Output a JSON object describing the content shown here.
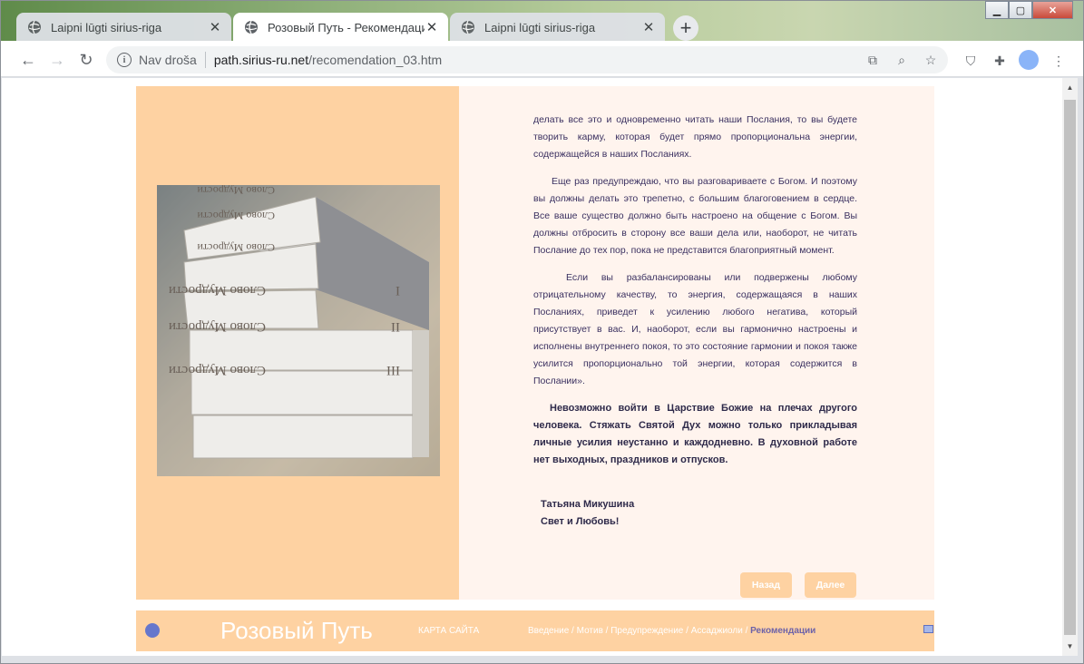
{
  "browser": {
    "tabs": [
      {
        "label": "Laipni lūgti sirius-riga",
        "active": false
      },
      {
        "label": "Розовый Путь - Рекомендации",
        "active": true
      },
      {
        "label": "Laipni lūgti sirius-riga",
        "active": false
      }
    ],
    "new_tab_icon": "plus-icon",
    "address": {
      "security_label": "Nav droša",
      "host": "path.sirius-ru.net",
      "path": "/recomendation_03.htm"
    }
  },
  "content": {
    "paragraphs": [
      "делать все это и одновременно читать наши Послания, то вы будете творить карму, которая будет прямо пропорциональна энергии, содержащейся в наших Посланиях.",
      "Еще раз предупреждаю, что вы разговариваете с Богом. И поэтому вы должны делать это трепетно, с большим благоговением в сердце. Все ваше существо должно быть настроено на общение с Богом. Вы должны отбросить в сторону все ваши дела или, наоборот, не читать Послание до тех пор, пока не представится благоприятный момент.",
      "Если вы разбалансированы или подвержены любому отрицательному качеству, то энергия, содержащаяся в наших Посланиях, приведет к усилению любого негатива, который присутствует в вас. И, наоборот, если вы гармонично настроены и исполнены внутреннего покоя, то это состояние гармонии и покоя также усилится пропорционально той энергии, которая содержится в Послании»."
    ],
    "bold_paragraph": "Невозможно войти в Царствие Божие на плечах другого человека. Стяжать Святой Дух можно только прикладывая личные усилия неустанно и каждодневно. В духовной работе нет выходных, праздников и отпусков.",
    "signature_name": "Татьяна Микушина",
    "signature_title": "Свет и Любовь!",
    "back_label": "Назад",
    "next_label": "Далее",
    "book_spines": [
      "Слово Мудрости",
      "I",
      "II",
      "III"
    ]
  },
  "footer": {
    "title": "Розовый Путь",
    "sitemap": "КАРТА САЙТА",
    "nav": [
      {
        "label": "Введение"
      },
      {
        "label": "Мотив"
      },
      {
        "label": "Предупреждение"
      },
      {
        "label": "Ассаджиоли"
      },
      {
        "label": "Рекомендации"
      }
    ]
  }
}
